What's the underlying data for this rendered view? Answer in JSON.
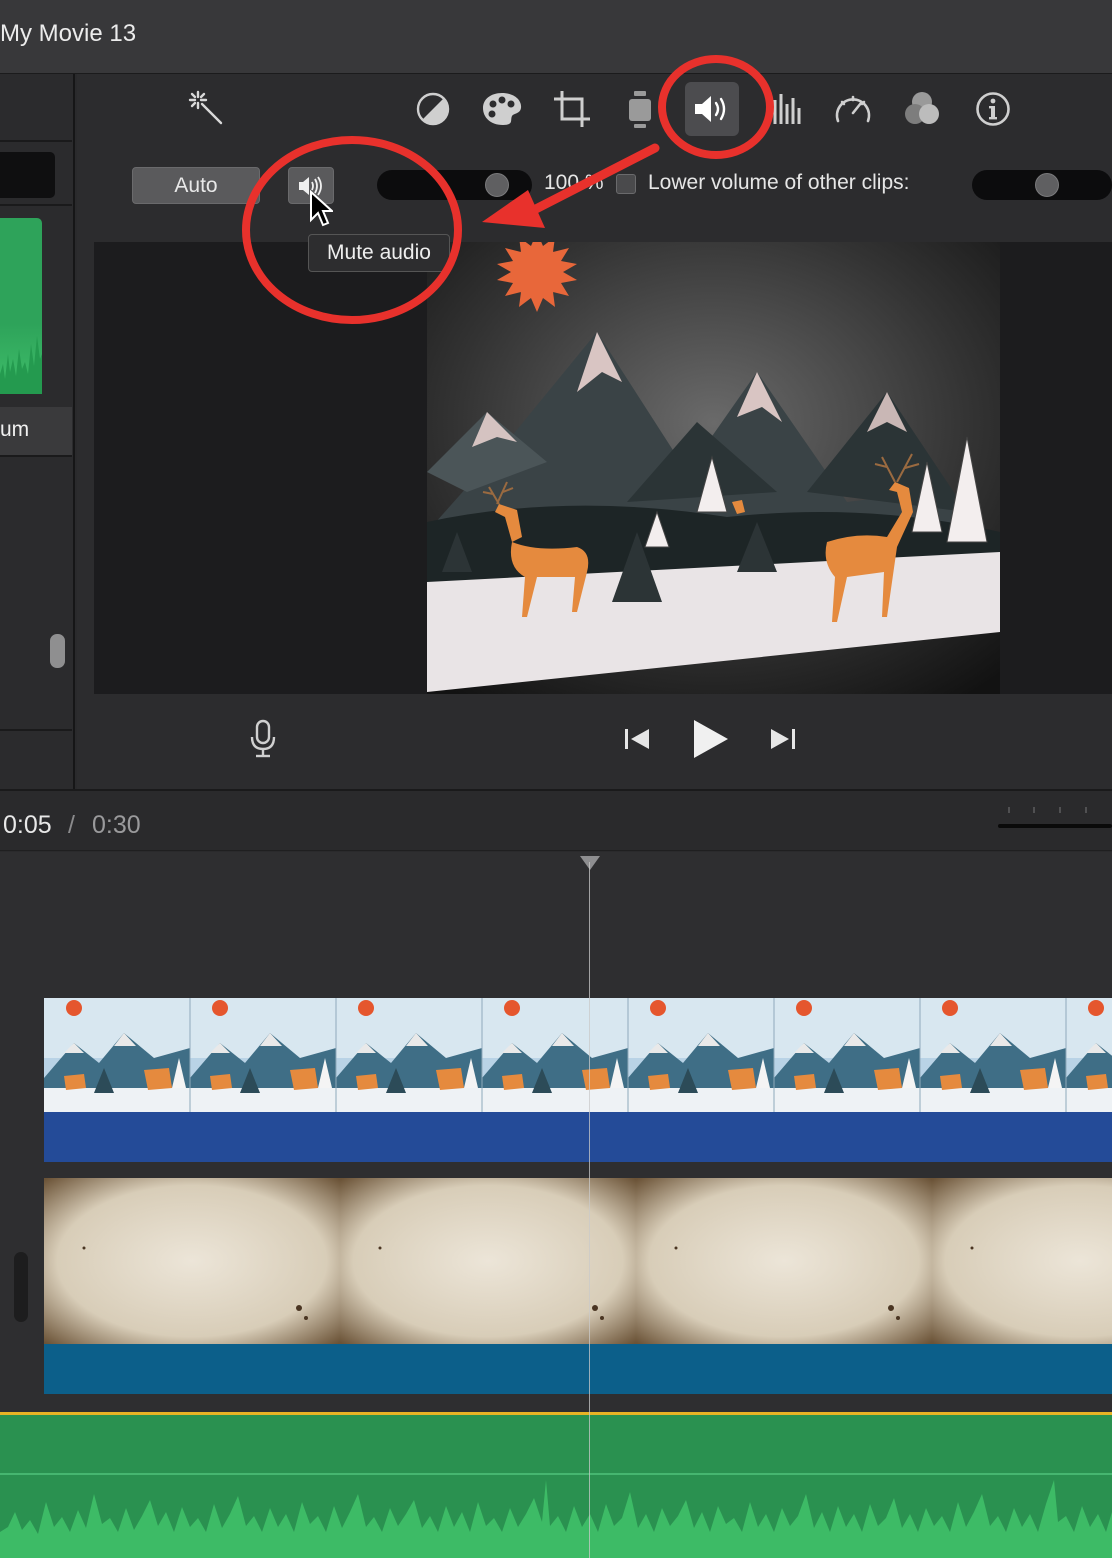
{
  "window": {
    "title": "My Movie 13"
  },
  "sidebar": {
    "item_label": "um"
  },
  "toolbar": {
    "icons": [
      "magic-wand-icon",
      "color-balance-icon",
      "color-correction-icon",
      "crop-icon",
      "stabilization-icon",
      "volume-icon",
      "equalizer-icon",
      "speed-icon",
      "clip-filter-icon",
      "info-icon"
    ],
    "active": "volume-icon"
  },
  "volume_controls": {
    "auto_label": "Auto",
    "mute_tooltip": "Mute audio",
    "volume_percent": "100 %",
    "volume_value": 100,
    "lower_volume_label": "Lower volume of other clips:",
    "lower_volume_checked": false
  },
  "timeline": {
    "current_time": "0:05",
    "separator": "/",
    "total_time": "0:30"
  },
  "colors": {
    "annotation_red": "#e8312c",
    "video_clip_bar": "#244b98",
    "background_clip_bar": "#0c5f8a",
    "audio_track": "#2a9150",
    "audio_track_border": "#e7b325"
  }
}
